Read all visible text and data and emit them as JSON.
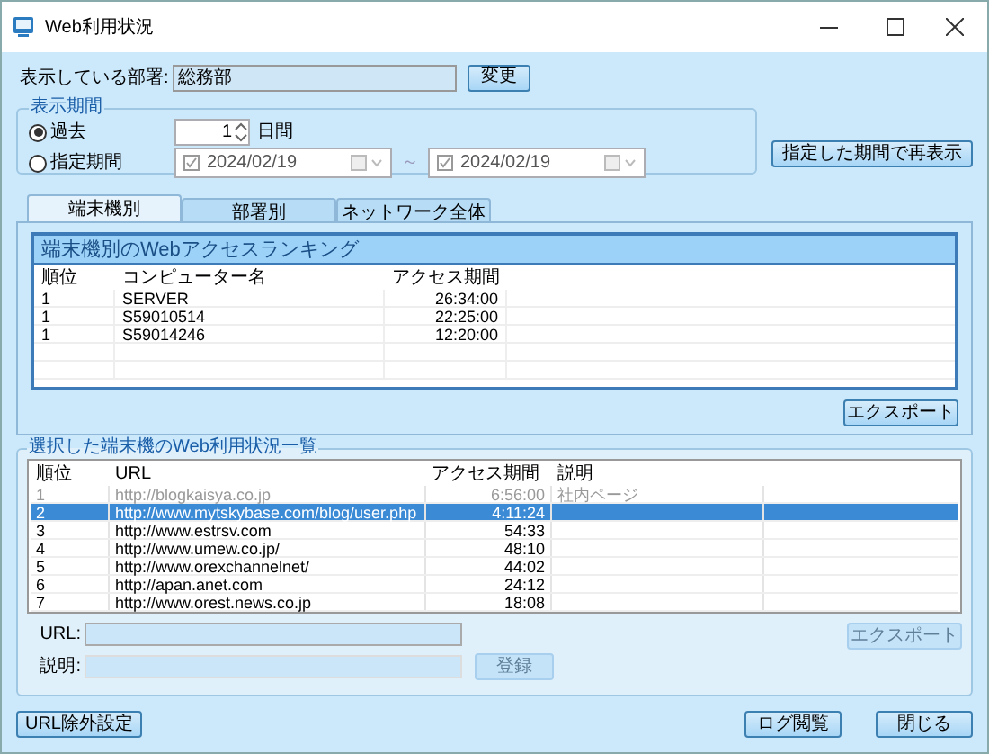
{
  "window": {
    "title": "Web利用状況"
  },
  "department": {
    "label": "表示している部署:",
    "value": "総務部",
    "button": "変更"
  },
  "period": {
    "title": "表示期間",
    "options": [
      {
        "label": "過去",
        "selected": true
      },
      {
        "label": "指定期間",
        "selected": false
      }
    ],
    "days": {
      "value": "1",
      "unit": "日間"
    },
    "from": {
      "value": "2024/02/19",
      "checked": true
    },
    "separator": "～",
    "to": {
      "value": "2024/02/19",
      "checked": true
    },
    "refresh_button": "指定した期間で再表示"
  },
  "tabs": [
    {
      "label": "端末機別",
      "selected": true
    },
    {
      "label": "部署別",
      "selected": false
    },
    {
      "label": "ネットワーク全体",
      "selected": false
    }
  ],
  "ranking": {
    "title": "端末機別のWebアクセスランキング",
    "columns": [
      "順位",
      "コンピューター名",
      "アクセス期間"
    ],
    "rows": [
      [
        "1",
        "SERVER",
        "26:34:00"
      ],
      [
        "1",
        "S59010514",
        "22:25:00"
      ],
      [
        "1",
        "S59014246",
        "12:20:00"
      ]
    ],
    "export_button": "エクスポート"
  },
  "usage": {
    "title": "選択した端末機のWeb利用状況一覧",
    "columns": [
      "順位",
      "URL",
      "アクセス期間",
      "説明"
    ],
    "rows": [
      {
        "cells": [
          "1",
          "http://blogkaisya.co.jp",
          "6:56:00",
          "社内ページ"
        ],
        "dimmed": true,
        "selected": false
      },
      {
        "cells": [
          "2",
          "http://www.mytskybase.com/blog/user.php",
          "4:11:24",
          ""
        ],
        "dimmed": false,
        "selected": true
      },
      {
        "cells": [
          "3",
          "http://www.estrsv.com",
          "54:33",
          ""
        ],
        "dimmed": false,
        "selected": false
      },
      {
        "cells": [
          "4",
          "http://www.umew.co.jp/",
          "48:10",
          ""
        ],
        "dimmed": false,
        "selected": false
      },
      {
        "cells": [
          "5",
          "http://www.orexchannelnet/",
          "44:02",
          ""
        ],
        "dimmed": false,
        "selected": false
      },
      {
        "cells": [
          "6",
          "http://apan.anet.com",
          "24:12",
          ""
        ],
        "dimmed": false,
        "selected": false
      },
      {
        "cells": [
          "7",
          "http://www.orest.news.co.jp",
          "18:08",
          ""
        ],
        "dimmed": false,
        "selected": false
      }
    ],
    "url_label": "URL:",
    "desc_label": "説明:",
    "export_button": "エクスポート",
    "register_button": "登録",
    "buttons_disabled": true
  },
  "footer": {
    "exclude_button": "URL除外設定",
    "log_button": "ログ閲覧",
    "close_button": "閉じる"
  }
}
